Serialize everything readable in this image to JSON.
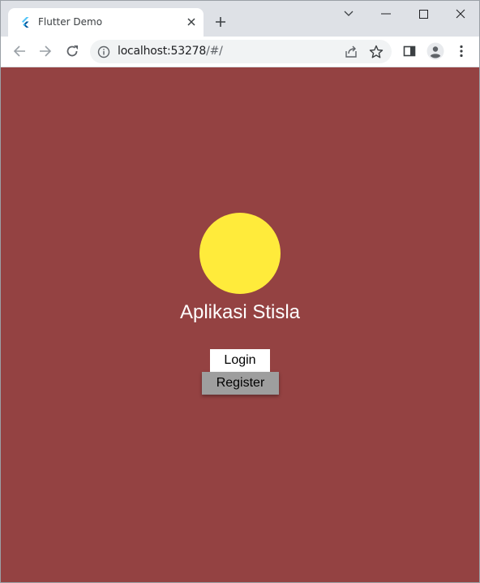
{
  "browser": {
    "tab": {
      "title": "Flutter Demo",
      "favicon": "flutter-logo-icon"
    },
    "address_bar": {
      "host": "localhost:53278",
      "path": "/#/"
    },
    "icons": {
      "close_tab": "close-icon",
      "new_tab": "plus-icon",
      "back": "arrow-left-icon",
      "forward": "arrow-right-icon",
      "reload": "reload-icon",
      "site_info": "info-icon",
      "share": "share-icon",
      "bookmark": "star-icon",
      "side_panel": "side-panel-icon",
      "profile": "profile-icon",
      "menu": "kebab-menu-icon"
    }
  },
  "page": {
    "background_color": "#944242",
    "logo_color": "#ffeb3b",
    "title": "Aplikasi Stisla",
    "buttons": {
      "login": "Login",
      "register": "Register"
    }
  }
}
